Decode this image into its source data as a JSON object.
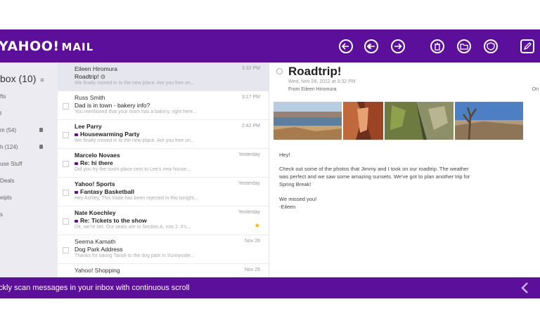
{
  "header": {
    "logo_text": "YAHOO!",
    "logo_mail": "MAIL",
    "toolbar_icons": [
      "reply-icon",
      "reply-all-icon",
      "forward-icon",
      "trash-icon",
      "folder-icon",
      "spam-icon",
      "compose-icon"
    ]
  },
  "folders": {
    "inbox_label": "box (10)",
    "inbox_chevron": "≡",
    "items": [
      {
        "label": "fts"
      },
      {
        "label": "t"
      },
      {
        "label": "m (54)"
      },
      {
        "label": "h (124)"
      },
      {
        "label": "use Stuff"
      },
      {
        "label": "Deals"
      },
      {
        "label": "eipts"
      },
      {
        "label": "s"
      }
    ]
  },
  "messages": [
    {
      "sender": "Eileen Hiromura",
      "subject": "Roadtrip! ⊙",
      "preview": "We finally moved in to the new place. Are you free on...",
      "date": "3:32 PM",
      "bold": false,
      "dot": false,
      "selected": true
    },
    {
      "sender": "Russ Smith",
      "subject": "Dad is in town - bakery info?",
      "preview": "You mentioned that your mom has a bakery, right here...",
      "date": "3:17 PM",
      "bold": false,
      "dot": false
    },
    {
      "sender": "Lee Parry",
      "subject": "Housewarming Party",
      "preview": "We finally moved in to the new place. Are you free on...",
      "date": "2:42 PM",
      "bold": true,
      "dot": true
    },
    {
      "sender": "Marcelo Novaes",
      "subject": "Re: hi there",
      "preview": "Did you try the sushi place next to Lee's new house...",
      "date": "Yesterday",
      "bold": true,
      "dot": true
    },
    {
      "sender": "Yahoo! Sports",
      "subject": "Fantasy Basketball",
      "preview": "Hey Ashley, This trade has been rejected in Rio tonight...",
      "date": "Yesterday",
      "bold": true,
      "dot": true
    },
    {
      "sender": "Nate Koechley",
      "subject": "Re: Tickets to the show",
      "preview": "Ok, we're set. Our seats are in Section A, row 2. It's...",
      "date": "Yesterday",
      "bold": true,
      "dot": true,
      "star": "★"
    },
    {
      "sender": "Seema Kamath",
      "subject": "Dog Park Address",
      "preview": "Thanks for taking Tanoli to the dog park in Sunnyvale...",
      "date": "Nov 26",
      "bold": false,
      "dot": false
    },
    {
      "sender": "Yahoo! Shopping",
      "subject": "",
      "preview": "",
      "date": "Nov 26",
      "bold": false,
      "dot": false
    }
  ],
  "reading": {
    "title": "Roadtrip!",
    "date": "Wed, Nov 28, 2012 at 3:32 PM",
    "from": "From Eileen Hiromura",
    "on_label": "On",
    "body_lines": [
      "Hey!",
      "Check out some of the photos that Jimmy and I took on our roadtrip. The weather",
      "was perfect and we saw some amazing sunsets. We've got to plan another trip for",
      "Spring Break!",
      "We missed you!",
      "-Eileen"
    ]
  },
  "footer": {
    "text": "ckly scan messages in your inbox with continuous scroll",
    "back_icon": "chevron-left-icon"
  },
  "colors": {
    "brand_purple": "#5b0f9a",
    "star_yellow": "#f0b400"
  }
}
